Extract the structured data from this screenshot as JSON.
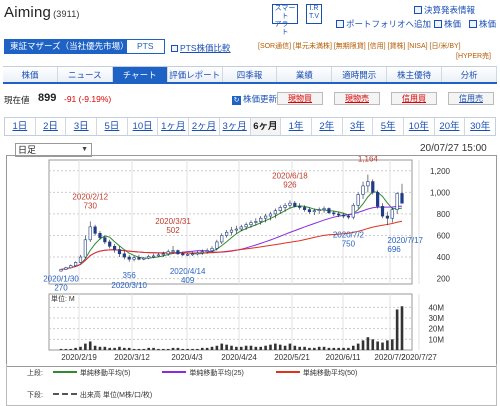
{
  "header": {
    "company": "Aiming",
    "code": "(3911)",
    "smart_alert": [
      "スマート",
      "アラート"
    ],
    "ir_tv": [
      "I.R",
      "T.V"
    ],
    "links": [
      "決算発表情報",
      "ポートフォリオへ追加",
      "株価",
      "株価"
    ]
  },
  "market": {
    "name": "東証マザーズ（当社優先市場）",
    "pts": "PTS",
    "pts_compare": "PTS株価比較",
    "tags": "[SOR通信] [単元未満株] [無期限貸] [信用] [貸株] [NISA] [日/米/BY]",
    "tags2": "[HYPER売]"
  },
  "tabs": [
    {
      "label": "株価",
      "active": false
    },
    {
      "label": "ニュース",
      "active": false
    },
    {
      "label": "チャート",
      "active": true
    },
    {
      "label": "評価レポート",
      "active": false
    },
    {
      "label": "四季報",
      "active": false
    },
    {
      "label": "業績",
      "active": false
    },
    {
      "label": "適時開示",
      "active": false
    },
    {
      "label": "株主優待",
      "active": false
    },
    {
      "label": "分析",
      "active": false
    }
  ],
  "quote": {
    "label": "現在値",
    "price": "899",
    "change": "-91 (-9.19%)",
    "refresh": "株価更新"
  },
  "trade_buttons": [
    "現物買",
    "現物売",
    "信用買",
    "信用売"
  ],
  "periods": [
    "1日",
    "2日",
    "3日",
    "5日",
    "10日",
    "1ヶ月",
    "2ヶ月",
    "3ヶ月",
    "6ヶ月",
    "1年",
    "2年",
    "3年",
    "5年",
    "10年",
    "20年",
    "30年"
  ],
  "active_period": "6ヶ月",
  "chart_controls": {
    "interval": "日足",
    "datetime": "20/07/27 15:00"
  },
  "chart_data": [
    {
      "type": "line",
      "title": "",
      "y_ticks": [
        200,
        400,
        600,
        800,
        "1,000",
        "1,200"
      ],
      "ylim": [
        150,
        1300
      ],
      "x_ticks": [
        "2020/2/19",
        "2020/3/12",
        "2020/4/3",
        "2020/4/24",
        "2020/5/21",
        "2020/6/11",
        "2020/7/2",
        "2020/7/27"
      ],
      "series": [
        {
          "name": "単純移動平均(5)",
          "color": "#2e8b2e"
        },
        {
          "name": "単純移動平均(25)",
          "color": "#8a2be2"
        },
        {
          "name": "単純移動平均(50)",
          "color": "#e03020"
        }
      ],
      "annotations": [
        {
          "date": "2020/1/30",
          "value": 270,
          "kind": "low"
        },
        {
          "date": "2020/2/12",
          "value": 730,
          "kind": "high"
        },
        {
          "date": "",
          "value": 356,
          "kind": "low"
        },
        {
          "date": "2020/3/10",
          "value": "",
          "kind": "low"
        },
        {
          "date": "2020/3/31",
          "value": 502,
          "kind": "high"
        },
        {
          "date": "2020/4/14",
          "value": 409,
          "kind": "low"
        },
        {
          "date": "2020/6/18",
          "value": 926,
          "kind": "high"
        },
        {
          "date": "2020/7/2",
          "value": 750,
          "kind": "low"
        },
        {
          "date": "2020/7/13",
          "value": "1,164",
          "kind": "high"
        },
        {
          "date": "2020/7/17",
          "value": 696,
          "kind": "low"
        }
      ],
      "candles": [
        [
          270,
          265,
          290,
          285
        ],
        [
          285,
          280,
          310,
          300
        ],
        [
          300,
          295,
          330,
          320
        ],
        [
          320,
          310,
          360,
          350
        ],
        [
          350,
          340,
          420,
          400
        ],
        [
          400,
          390,
          600,
          560
        ],
        [
          560,
          540,
          730,
          680
        ],
        [
          680,
          600,
          700,
          620
        ],
        [
          620,
          560,
          640,
          580
        ],
        [
          580,
          520,
          600,
          540
        ],
        [
          540,
          480,
          560,
          500
        ],
        [
          500,
          440,
          520,
          470
        ],
        [
          470,
          400,
          500,
          430
        ],
        [
          430,
          380,
          460,
          400
        ],
        [
          400,
          356,
          420,
          380
        ],
        [
          380,
          360,
          410,
          395
        ],
        [
          395,
          370,
          420,
          380
        ],
        [
          380,
          370,
          400,
          390
        ],
        [
          390,
          380,
          420,
          405
        ],
        [
          405,
          390,
          430,
          410
        ],
        [
          410,
          400,
          440,
          420
        ],
        [
          420,
          400,
          450,
          430
        ],
        [
          430,
          410,
          470,
          450
        ],
        [
          450,
          430,
          502,
          460
        ],
        [
          460,
          420,
          470,
          430
        ],
        [
          430,
          410,
          450,
          420
        ],
        [
          420,
          409,
          440,
          425
        ],
        [
          425,
          410,
          450,
          430
        ],
        [
          430,
          415,
          460,
          440
        ],
        [
          440,
          420,
          470,
          450
        ],
        [
          450,
          430,
          480,
          460
        ],
        [
          460,
          440,
          500,
          480
        ],
        [
          480,
          460,
          560,
          540
        ],
        [
          540,
          520,
          620,
          600
        ],
        [
          600,
          580,
          650,
          630
        ],
        [
          630,
          600,
          680,
          650
        ],
        [
          650,
          620,
          690,
          660
        ],
        [
          660,
          640,
          700,
          680
        ],
        [
          680,
          650,
          720,
          700
        ],
        [
          700,
          670,
          740,
          720
        ],
        [
          720,
          690,
          760,
          730
        ],
        [
          730,
          700,
          780,
          760
        ],
        [
          760,
          720,
          800,
          780
        ],
        [
          780,
          740,
          820,
          800
        ],
        [
          800,
          760,
          850,
          830
        ],
        [
          830,
          800,
          880,
          860
        ],
        [
          860,
          820,
          900,
          880
        ],
        [
          880,
          850,
          926,
          900
        ],
        [
          900,
          860,
          920,
          870
        ],
        [
          870,
          840,
          900,
          860
        ],
        [
          860,
          820,
          880,
          840
        ],
        [
          840,
          800,
          860,
          820
        ],
        [
          820,
          790,
          850,
          830
        ],
        [
          830,
          800,
          860,
          840
        ],
        [
          840,
          810,
          870,
          850
        ],
        [
          850,
          800,
          860,
          810
        ],
        [
          810,
          780,
          830,
          800
        ],
        [
          800,
          770,
          820,
          790
        ],
        [
          790,
          760,
          810,
          780
        ],
        [
          780,
          750,
          800,
          770
        ],
        [
          770,
          750,
          900,
          880
        ],
        [
          880,
          850,
          1000,
          980
        ],
        [
          980,
          940,
          1100,
          1060
        ],
        [
          1060,
          1000,
          1164,
          1100
        ],
        [
          1100,
          980,
          1120,
          1000
        ],
        [
          1000,
          850,
          1020,
          870
        ],
        [
          870,
          760,
          900,
          780
        ],
        [
          780,
          696,
          820,
          760
        ],
        [
          760,
          720,
          860,
          840
        ],
        [
          840,
          800,
          1000,
          990
        ],
        [
          990,
          899,
          1080,
          899
        ]
      ],
      "volume_ticks": [
        "40M",
        "30M",
        "20M",
        "10M"
      ],
      "volume_label": "単位: M",
      "volume": [
        1,
        1,
        1,
        2,
        3,
        6,
        8,
        4,
        3,
        3,
        2,
        2,
        3,
        2,
        2,
        1,
        1,
        1,
        2,
        2,
        1,
        1,
        1,
        2,
        2,
        1,
        1,
        1,
        1,
        2,
        2,
        3,
        4,
        6,
        5,
        4,
        3,
        3,
        4,
        4,
        3,
        3,
        4,
        5,
        6,
        5,
        4,
        6,
        4,
        3,
        3,
        2,
        2,
        3,
        3,
        2,
        2,
        2,
        2,
        2,
        4,
        6,
        9,
        12,
        10,
        8,
        7,
        9,
        10,
        38,
        41
      ]
    }
  ],
  "legend": {
    "upper_label": "上段:",
    "lower_label": "下段:",
    "upper_items": [
      "単純移動平均(5)",
      "単純移動平均(25)",
      "単純移動平均(50)"
    ],
    "lower_item": "出来高 単位(M株/口/枚)"
  }
}
